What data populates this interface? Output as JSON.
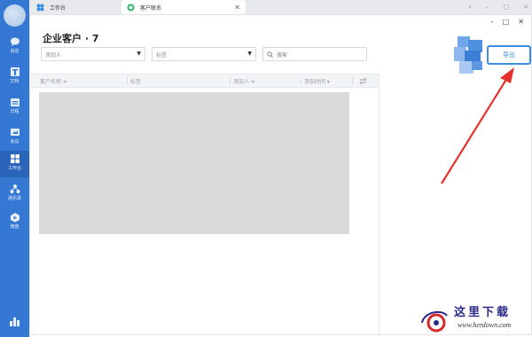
{
  "tabs": [
    {
      "label": "工作台",
      "active": false
    },
    {
      "label": "客户联系",
      "active": true
    }
  ],
  "window_controls": {
    "min": "–",
    "max": "□",
    "close": "✕"
  },
  "sidebar": {
    "items": [
      {
        "label": "消息",
        "icon": "chat-icon"
      },
      {
        "label": "文档",
        "icon": "doc-icon"
      },
      {
        "label": "日程",
        "icon": "calendar-icon"
      },
      {
        "label": "会议",
        "icon": "meeting-icon"
      },
      {
        "label": "工作台",
        "icon": "grid-icon",
        "active": true
      },
      {
        "label": "通讯录",
        "icon": "contacts-icon"
      },
      {
        "label": "微盘",
        "icon": "drive-icon"
      }
    ]
  },
  "page": {
    "title": "企业客户 · 7",
    "filters": {
      "adder": "添加人",
      "tag": "标签",
      "search_placeholder": "搜索"
    },
    "export_label": "导出",
    "table": {
      "columns": [
        "客户名称 ≑",
        "标签",
        "添加人 ≑",
        "添加时间 ▾"
      ]
    }
  },
  "watermark": {
    "cn": "这里下载",
    "url": "www.herdown.com"
  },
  "colors": {
    "sidebar": "#3478d4",
    "accent": "#3c8fe0",
    "arrow": "#e5322d",
    "placeholder": "#dadada"
  }
}
